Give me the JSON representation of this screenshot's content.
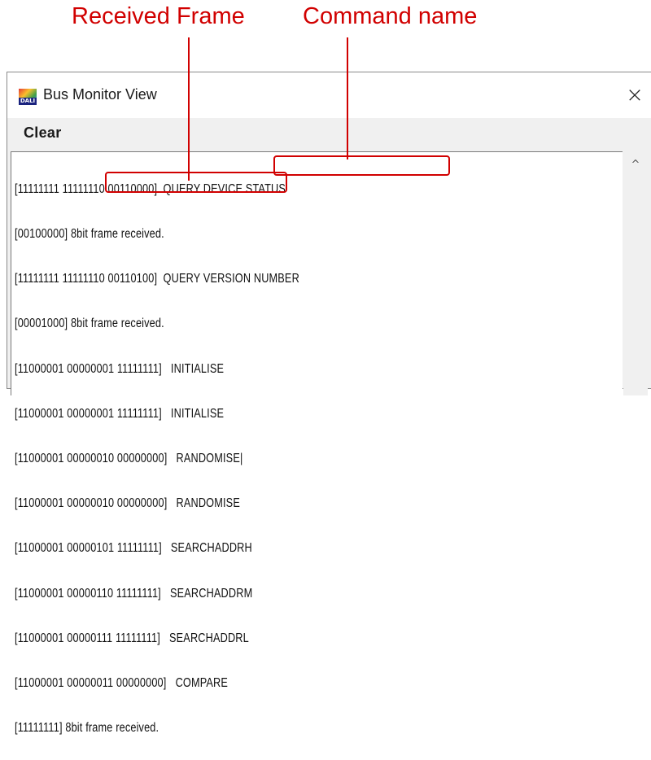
{
  "callouts": {
    "received_frame": "Received Frame",
    "command_name": "Command name"
  },
  "window": {
    "title": "Bus Monitor View",
    "app_icon_label": "DALI",
    "close_glyph": "×"
  },
  "toolbar": {
    "clear_label": "Clear"
  },
  "log": {
    "lines": [
      "[11111111 11111110 00110000]  QUERY DEVICE STATUS",
      "[00100000] 8bit frame received.",
      "[11111111 11111110 00110100]  QUERY VERSION NUMBER",
      "[00001000] 8bit frame received.",
      "[11000001 00000001 11111111]   INITIALISE",
      "[11000001 00000001 11111111]   INITIALISE",
      "[11000001 00000010 00000000]   RANDOMISE|",
      "[11000001 00000010 00000000]   RANDOMISE",
      "[11000001 00000101 11111111]   SEARCHADDRH",
      "[11000001 00000110 11111111]   SEARCHADDRM",
      "[11000001 00000111 11111111]   SEARCHADDRL",
      "[11000001 00000011 00000000]   COMPARE",
      "[11111111] 8bit frame received."
    ]
  },
  "scrollbar": {
    "up_glyph": "^"
  },
  "colors": {
    "callout": "#d10000",
    "window_bg": "#f0f0f0",
    "log_bg": "#ffffff"
  }
}
